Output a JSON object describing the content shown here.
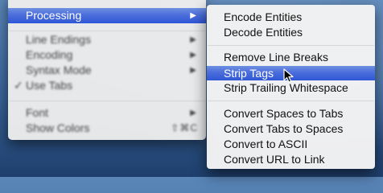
{
  "parent_menu": {
    "items": [
      {
        "label": "Processing",
        "arrow": "▶",
        "active": true
      },
      {
        "label": "Line Endings",
        "arrow": "▶"
      },
      {
        "label": "Encoding",
        "arrow": "▶"
      },
      {
        "label": "Syntax Mode",
        "arrow": "▶"
      },
      {
        "label": "Use Tabs",
        "check": "✓"
      },
      {
        "label": "Font",
        "arrow": "▶"
      },
      {
        "label": "Show Colors",
        "shortcut": "⇧⌘C"
      }
    ]
  },
  "submenu": {
    "items": [
      {
        "label": "Encode Entities"
      },
      {
        "label": "Decode Entities"
      },
      {
        "label": "Remove Line Breaks"
      },
      {
        "label": "Strip Tags",
        "highlighted": true
      },
      {
        "label": "Strip Trailing Whitespace"
      },
      {
        "label": "Convert Spaces to Tabs"
      },
      {
        "label": "Convert Tabs to Spaces"
      },
      {
        "label": "Convert to ASCII"
      },
      {
        "label": "Convert URL to Link"
      }
    ]
  },
  "colors": {
    "highlight": "#3e62d8",
    "menu_bg": "#f2f2f2"
  }
}
